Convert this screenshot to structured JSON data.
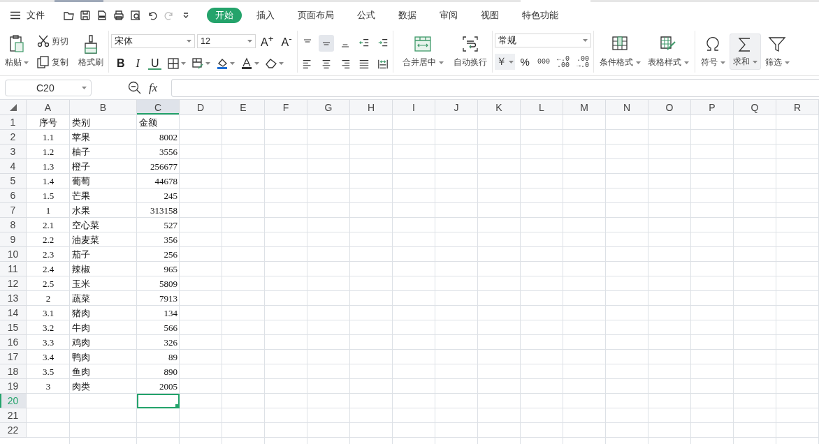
{
  "menu": {
    "label": "文件"
  },
  "tabs": [
    {
      "label": "开始",
      "selected": true
    },
    {
      "label": "插入",
      "selected": false
    },
    {
      "label": "页面布局",
      "selected": false
    },
    {
      "label": "公式",
      "selected": false
    },
    {
      "label": "数据",
      "selected": false
    },
    {
      "label": "审阅",
      "selected": false
    },
    {
      "label": "视图",
      "selected": false
    },
    {
      "label": "特色功能",
      "selected": false
    }
  ],
  "ribbon": {
    "paste": "粘贴",
    "cut": "剪切",
    "copy": "复制",
    "format_painter": "格式刷",
    "font_name": "宋体",
    "font_size": "12",
    "grow_font": "A$^{+}$",
    "shrink_font": "A$^{-}$",
    "bold": "B",
    "italic": "I",
    "underline": "U",
    "align_buttons": [
      {
        "kind": "top",
        "selected": false
      },
      {
        "kind": "middle",
        "selected": true
      },
      {
        "kind": "bottom",
        "selected": false
      },
      {
        "kind": "outdent",
        "selected": false
      },
      {
        "kind": "indent",
        "selected": false
      },
      {
        "kind": "left",
        "selected": false
      },
      {
        "kind": "center",
        "selected": false
      },
      {
        "kind": "right",
        "selected": false
      },
      {
        "kind": "justify",
        "selected": false
      },
      {
        "kind": "distributed",
        "selected": false
      }
    ],
    "merge": "合并居中",
    "wrap": "自动换行",
    "number_format": "常规",
    "currency": "￥",
    "percent": "%",
    "thousands": "000",
    "decimal_buttons": [
      {
        "top": "←.0",
        "bottom": ".00"
      },
      {
        "top": ".00",
        "bottom": "→.0"
      }
    ],
    "tools": [
      {
        "kind": "conditional",
        "label": "条件格式",
        "highlighted": false
      },
      {
        "kind": "table-style",
        "label": "表格样式",
        "highlighted": false
      },
      {
        "kind": "symbol",
        "label": "符号",
        "highlighted": false
      },
      {
        "kind": "sum",
        "label": "求和",
        "highlighted": true
      },
      {
        "kind": "filter",
        "label": "筛选",
        "highlighted": false
      }
    ]
  },
  "formula_bar": {
    "name_box": "C20",
    "fx": "fx"
  },
  "sheet": {
    "columns": [
      {
        "label": "A",
        "selected": false
      },
      {
        "label": "B",
        "selected": false
      },
      {
        "label": "C",
        "selected": true
      },
      {
        "label": "D",
        "selected": false
      },
      {
        "label": "E",
        "selected": false
      },
      {
        "label": "F",
        "selected": false
      },
      {
        "label": "G",
        "selected": false
      },
      {
        "label": "H",
        "selected": false
      },
      {
        "label": "I",
        "selected": false
      },
      {
        "label": "J",
        "selected": false
      },
      {
        "label": "K",
        "selected": false
      },
      {
        "label": "L",
        "selected": false
      },
      {
        "label": "M",
        "selected": false
      },
      {
        "label": "N",
        "selected": false
      },
      {
        "label": "O",
        "selected": false
      },
      {
        "label": "P",
        "selected": false
      },
      {
        "label": "Q",
        "selected": false
      },
      {
        "label": "R",
        "selected": false
      }
    ],
    "rows": [
      {
        "label": "1",
        "kind": "header",
        "selected": false,
        "cells": [
          "序号",
          "类别",
          "金额"
        ]
      },
      {
        "label": "2",
        "kind": "data",
        "selected": false,
        "cells": [
          "1.1",
          "苹果",
          "8002"
        ]
      },
      {
        "label": "3",
        "kind": "data",
        "selected": false,
        "cells": [
          "1.2",
          "柚子",
          "3556"
        ]
      },
      {
        "label": "4",
        "kind": "data",
        "selected": false,
        "cells": [
          "1.3",
          "橙子",
          "256677"
        ]
      },
      {
        "label": "5",
        "kind": "data",
        "selected": false,
        "cells": [
          "1.4",
          "葡萄",
          "44678"
        ]
      },
      {
        "label": "6",
        "kind": "data",
        "selected": false,
        "cells": [
          "1.5",
          "芒果",
          "245"
        ]
      },
      {
        "label": "7",
        "kind": "data",
        "selected": false,
        "cells": [
          "1",
          "水果",
          "313158"
        ]
      },
      {
        "label": "8",
        "kind": "data",
        "selected": false,
        "cells": [
          "2.1",
          "空心菜",
          "527"
        ]
      },
      {
        "label": "9",
        "kind": "data",
        "selected": false,
        "cells": [
          "2.2",
          "油麦菜",
          "356"
        ]
      },
      {
        "label": "10",
        "kind": "data",
        "selected": false,
        "cells": [
          "2.3",
          "茄子",
          "256"
        ]
      },
      {
        "label": "11",
        "kind": "data",
        "selected": false,
        "cells": [
          "2.4",
          "辣椒",
          "965"
        ]
      },
      {
        "label": "12",
        "kind": "data",
        "selected": false,
        "cells": [
          "2.5",
          "玉米",
          "5809"
        ]
      },
      {
        "label": "13",
        "kind": "data",
        "selected": false,
        "cells": [
          "2",
          "蔬菜",
          "7913"
        ]
      },
      {
        "label": "14",
        "kind": "data",
        "selected": false,
        "cells": [
          "3.1",
          "猪肉",
          "134"
        ]
      },
      {
        "label": "15",
        "kind": "data",
        "selected": false,
        "cells": [
          "3.2",
          "牛肉",
          "566"
        ]
      },
      {
        "label": "16",
        "kind": "data",
        "selected": false,
        "cells": [
          "3.3",
          "鸡肉",
          "326"
        ]
      },
      {
        "label": "17",
        "kind": "data",
        "selected": false,
        "cells": [
          "3.4",
          "鸭肉",
          "89"
        ]
      },
      {
        "label": "18",
        "kind": "data",
        "selected": false,
        "cells": [
          "3.5",
          "鱼肉",
          "890"
        ]
      },
      {
        "label": "19",
        "kind": "data",
        "selected": false,
        "cells": [
          "3",
          "肉类",
          "2005"
        ]
      },
      {
        "label": "20",
        "selected": true,
        "cells": []
      },
      {
        "label": "21",
        "selected": false,
        "cells": []
      },
      {
        "label": "22",
        "selected": false,
        "cells": []
      }
    ]
  }
}
